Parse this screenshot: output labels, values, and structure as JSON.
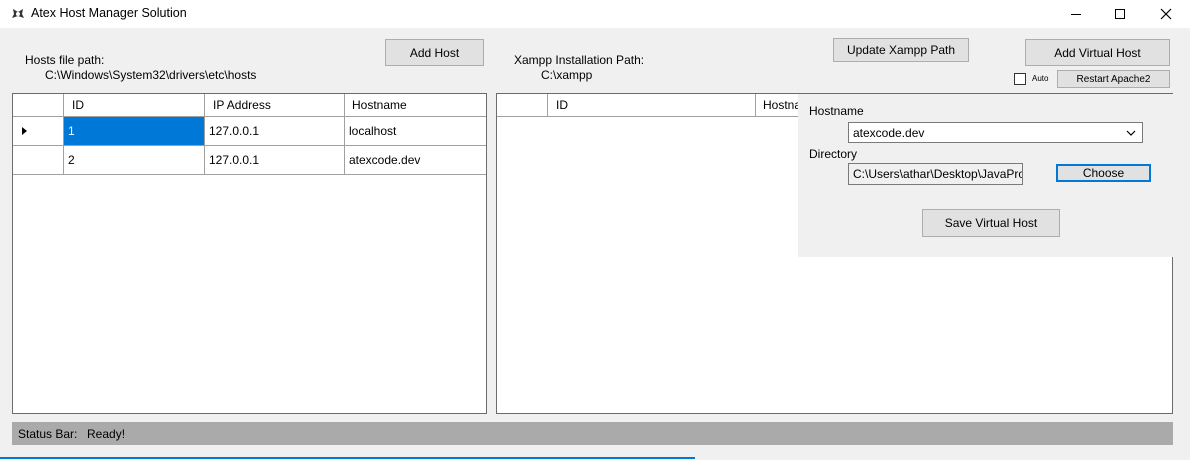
{
  "window": {
    "title": "Atex Host Manager Solution",
    "controls": [
      "minimize",
      "maximize",
      "close"
    ]
  },
  "hosts_section": {
    "path_label": "Hosts file path:",
    "path_value": "C:\\Windows\\System32\\drivers\\etc\\hosts",
    "add_host_button": "Add Host",
    "columns": [
      "ID",
      "IP Address",
      "Hostname"
    ],
    "rows": [
      {
        "id": "1",
        "ip": "127.0.0.1",
        "hostname": "localhost",
        "current": true
      },
      {
        "id": "2",
        "ip": "127.0.0.1",
        "hostname": "atexcode.dev",
        "current": false
      }
    ]
  },
  "xampp_section": {
    "path_label": "Xampp Installation Path:",
    "path_value": "C:\\xampp",
    "update_button": "Update Xampp Path",
    "add_vhost_button": "Add Virtual Host",
    "auto_label": "Auto",
    "auto_checked": false,
    "restart_button": "Restart Apache2",
    "columns": [
      "ID",
      "Hostna"
    ]
  },
  "vhost_panel": {
    "hostname_label": "Hostname",
    "hostname_value": "atexcode.dev",
    "directory_label": "Directory",
    "directory_value": "C:\\Users\\athar\\Desktop\\JavaProj",
    "choose_button": "Choose",
    "save_button": "Save Virtual Host"
  },
  "status_bar": {
    "label": "Status Bar:",
    "text": "Ready!"
  },
  "icons": {
    "app": "app-logo-icon",
    "minimize": "minimize-icon",
    "maximize": "maximize-icon",
    "close": "close-icon",
    "row_pointer": "row-pointer-icon",
    "dropdown": "chevron-down-icon"
  }
}
